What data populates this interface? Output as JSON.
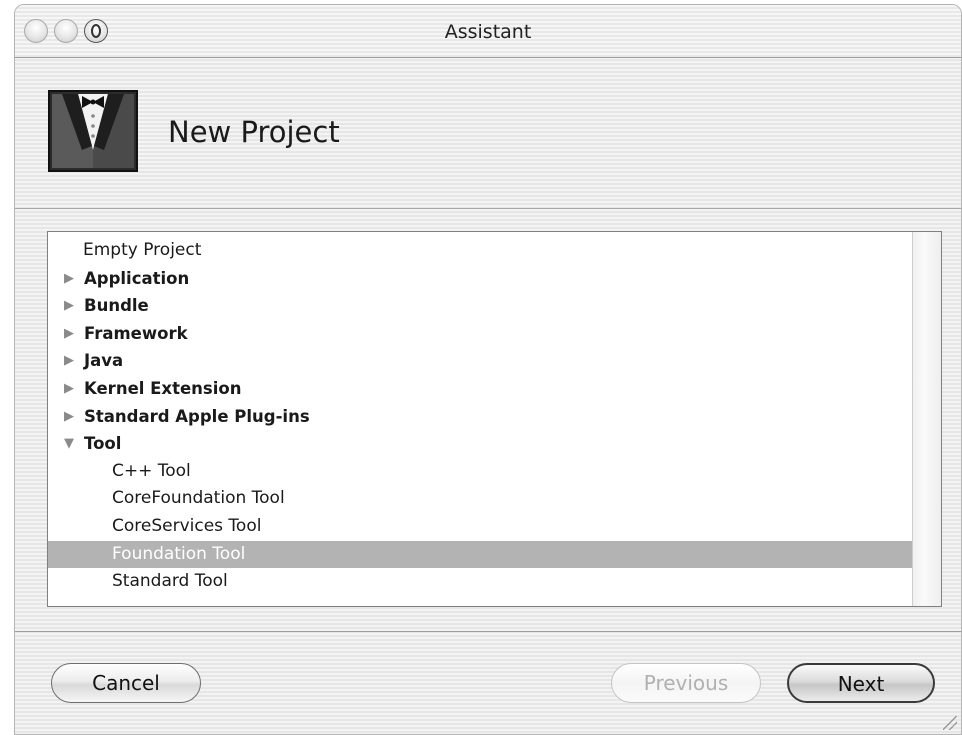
{
  "window": {
    "title": "Assistant"
  },
  "header": {
    "title": "New Project",
    "icon": "tuxedo-icon"
  },
  "templates": [
    {
      "label": "Empty Project",
      "level": 0,
      "bold": false,
      "disclosure": "none",
      "selected": false
    },
    {
      "label": "Application",
      "level": 0,
      "bold": true,
      "disclosure": "collapsed",
      "selected": false
    },
    {
      "label": "Bundle",
      "level": 0,
      "bold": true,
      "disclosure": "collapsed",
      "selected": false
    },
    {
      "label": "Framework",
      "level": 0,
      "bold": true,
      "disclosure": "collapsed",
      "selected": false
    },
    {
      "label": "Java",
      "level": 0,
      "bold": true,
      "disclosure": "collapsed",
      "selected": false
    },
    {
      "label": "Kernel Extension",
      "level": 0,
      "bold": true,
      "disclosure": "collapsed",
      "selected": false
    },
    {
      "label": "Standard Apple Plug-ins",
      "level": 0,
      "bold": true,
      "disclosure": "collapsed",
      "selected": false
    },
    {
      "label": "Tool",
      "level": 0,
      "bold": true,
      "disclosure": "expanded",
      "selected": false
    },
    {
      "label": "C++ Tool",
      "level": 1,
      "bold": false,
      "disclosure": "none",
      "selected": false
    },
    {
      "label": "CoreFoundation Tool",
      "level": 1,
      "bold": false,
      "disclosure": "none",
      "selected": false
    },
    {
      "label": "CoreServices Tool",
      "level": 1,
      "bold": false,
      "disclosure": "none",
      "selected": false
    },
    {
      "label": "Foundation Tool",
      "level": 1,
      "bold": false,
      "disclosure": "none",
      "selected": true
    },
    {
      "label": "Standard Tool",
      "level": 1,
      "bold": false,
      "disclosure": "none",
      "selected": false
    }
  ],
  "footer": {
    "cancel_label": "Cancel",
    "previous_label": "Previous",
    "next_label": "Next"
  },
  "colors": {
    "selection": "#b3b3b3",
    "disabled_text": "#b0b0b0"
  }
}
